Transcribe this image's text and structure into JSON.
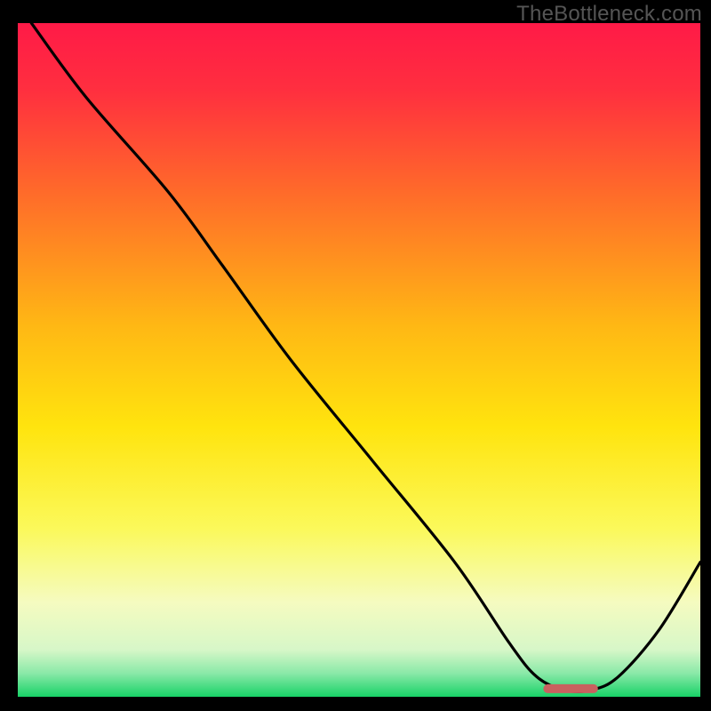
{
  "attribution": "TheBottleneck.com",
  "chart_data": {
    "type": "line",
    "title": "",
    "xlabel": "",
    "ylabel": "",
    "xlim": [
      0,
      100
    ],
    "ylim": [
      0,
      100
    ],
    "gradient_stops": [
      {
        "offset": 0.0,
        "color": "#ff1a47"
      },
      {
        "offset": 0.1,
        "color": "#ff2f3f"
      },
      {
        "offset": 0.25,
        "color": "#ff6a2a"
      },
      {
        "offset": 0.45,
        "color": "#ffb814"
      },
      {
        "offset": 0.6,
        "color": "#ffe40e"
      },
      {
        "offset": 0.75,
        "color": "#fbf95a"
      },
      {
        "offset": 0.86,
        "color": "#f5fbc0"
      },
      {
        "offset": 0.93,
        "color": "#d7f7c8"
      },
      {
        "offset": 0.965,
        "color": "#8ae9a8"
      },
      {
        "offset": 1.0,
        "color": "#18d267"
      }
    ],
    "series": [
      {
        "name": "bottleneck-curve",
        "color": "#000000",
        "x": [
          2,
          10,
          22,
          30,
          40,
          52,
          64,
          72,
          76,
          80,
          84,
          88,
          94,
          100
        ],
        "y": [
          100,
          89,
          75,
          64,
          50,
          35,
          20,
          8,
          3,
          1,
          1,
          3,
          10,
          20
        ]
      }
    ],
    "optimum_marker": {
      "x_start": 77,
      "x_end": 85,
      "y": 1.2,
      "color": "#c9615f"
    }
  }
}
